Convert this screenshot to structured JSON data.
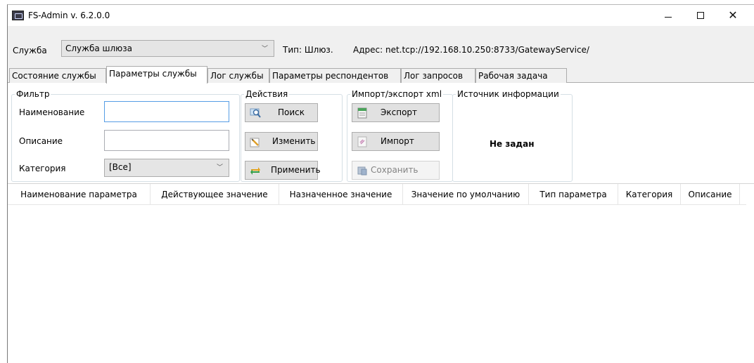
{
  "window": {
    "title": "FS-Admin v. 6.2.0.0",
    "controls": {
      "minimize": "—",
      "maximize": "☐",
      "close": "✕"
    }
  },
  "service_bar": {
    "label": "Служба",
    "selected": "Служба шлюза",
    "type_text": "Тип: Шлюз.",
    "address_text": "Адрес: net.tcp://192.168.10.250:8733/GatewayService/"
  },
  "tabs": [
    {
      "label": "Состояние службы",
      "active": false
    },
    {
      "label": "Параметры службы",
      "active": true
    },
    {
      "label": "Лог службы",
      "active": false
    },
    {
      "label": "Параметры респондентов",
      "active": false
    },
    {
      "label": "Лог запросов",
      "active": false
    },
    {
      "label": "Рабочая задача",
      "active": false
    }
  ],
  "filter": {
    "title": "Фильтр",
    "name_label": "Наименование",
    "name_value": "",
    "description_label": "Описание",
    "description_value": "",
    "category_label": "Категория",
    "category_value": "[Все]"
  },
  "actions": {
    "title": "Действия",
    "search": "Поиск",
    "edit": "Изменить",
    "apply": "Применить"
  },
  "xml": {
    "title": "Импорт/экспорт xml",
    "export": "Экспорт",
    "import": "Импорт",
    "save": "Сохранить"
  },
  "source": {
    "title": "Источник информации",
    "value": "Не задан"
  },
  "grid": {
    "columns": [
      "Наименование параметра",
      "Действующее значение",
      "Назначенное значение",
      "Значение по умолчанию",
      "Тип параметра",
      "Категория",
      "Описание"
    ],
    "rows": []
  },
  "icons": {
    "app": "fs-admin-app-icon",
    "search": "magnifier-icon",
    "edit": "pencil-icon",
    "apply": "refresh-arrows-icon",
    "export": "export-sheet-icon",
    "import": "import-sheet-icon",
    "save": "save-disk-icon"
  }
}
